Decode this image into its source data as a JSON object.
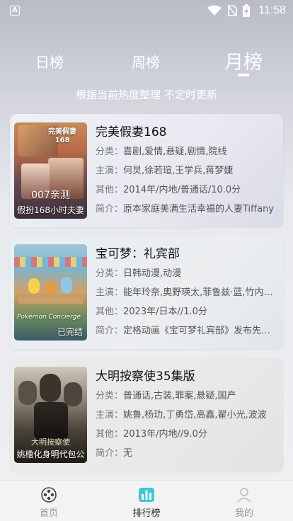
{
  "status_bar": {
    "time": "11:58",
    "left_badge": "A"
  },
  "tabs": [
    {
      "label": "日榜",
      "active": false
    },
    {
      "label": "周榜",
      "active": false
    },
    {
      "label": "月榜",
      "active": true
    }
  ],
  "subtitle": "根据当前热度整理 不定时更新",
  "labels": {
    "category": "分类：",
    "cast": "主演：",
    "other": "其他：",
    "intro": "简介："
  },
  "items": [
    {
      "title": "完美假妻168",
      "category": "喜剧,爱情,悬疑,剧情,院线",
      "cast": "何炅,徐若瑄,王学兵,蒋梦婕",
      "other": "2014年/内地/普通话/10.0分",
      "intro": "原本家庭美满生活幸福的人妻Tiffany",
      "poster_badge": "007亲测",
      "poster_caption": "假扮168小时夫妻",
      "poster_title_art": "完美假妻168"
    },
    {
      "title": "宝可梦：礼宾部",
      "category": "日韩动漫,动漫",
      "cast": "能年玲奈,奥野瑛太,菲鲁兹·蓝,竹内凉真",
      "other": "2023年/日本//1.0分",
      "intro": "定格动画《宝可梦礼宾部》发布先导预告",
      "poster_caption": "已完结",
      "poster_title_art": "Pokémon Concierge"
    },
    {
      "title": "大明按察使35集版",
      "category": "普通话,古装,罪案,悬疑,国产",
      "cast": "姚鲁,杨玏,丁勇岱,高鑫,翟小光,波波",
      "other": "2013年/内地//9.0分",
      "intro": "无",
      "poster_caption": "姚橹化身明代包公",
      "poster_title_art": "大明按察使"
    }
  ],
  "bottom_nav": [
    {
      "label": "首页",
      "icon": "film-reel-icon",
      "active": false
    },
    {
      "label": "排行榜",
      "icon": "ranking-chart-icon",
      "active": true
    },
    {
      "label": "我的",
      "icon": "profile-icon",
      "active": false
    }
  ],
  "colors": {
    "accent_ranking": "#3ec6d8",
    "text_primary": "#111111",
    "text_secondary": "#777777"
  }
}
